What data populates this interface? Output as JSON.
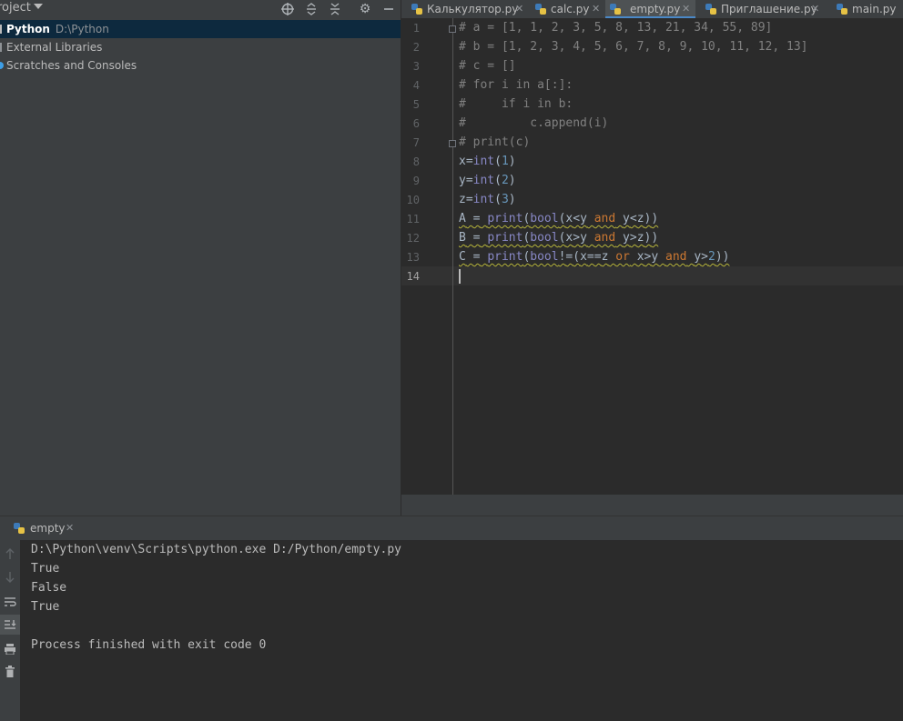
{
  "project_panel": {
    "title": "roject",
    "tree": [
      {
        "name": "Python",
        "path": "D:\\Python"
      },
      {
        "name": "External Libraries"
      },
      {
        "name": "Scratches and Consoles"
      }
    ],
    "icons": [
      "locate-icon",
      "expand-all-icon",
      "collapse-all-icon",
      "gear-icon",
      "minimize-icon"
    ]
  },
  "tabs": [
    {
      "label": "Калькулятор.py",
      "active": false
    },
    {
      "label": "calc.py",
      "active": false
    },
    {
      "label": "empty.py",
      "active": true
    },
    {
      "label": "Приглашение.py",
      "active": false
    },
    {
      "label": "main.py",
      "active": false
    }
  ],
  "tab_close_glyph": "✕",
  "editor": {
    "line_numbers": [
      "1",
      "2",
      "3",
      "4",
      "5",
      "6",
      "7",
      "8",
      "9",
      "10",
      "11",
      "12",
      "13",
      "14"
    ],
    "current_line": 14,
    "lines": [
      "# a = [1, 1, 2, 3, 5, 8, 13, 21, 34, 55, 89]",
      "# b = [1, 2, 3, 4, 5, 6, 7, 8, 9, 10, 11, 12, 13]",
      "# c = []",
      "# for i in a[:]:",
      "#     if i in b:",
      "#         c.append(i)",
      "# print(c)",
      "x=int(1)",
      "y=int(2)",
      "z=int(3)",
      "A = print(bool(x<y and y<z))",
      "B = print(bool(x>y and y>z))",
      "C = print(bool!=(x==z or x>y and y>2))",
      ""
    ]
  },
  "run": {
    "tab_label": "empty",
    "output": [
      "D:\\Python\\venv\\Scripts\\python.exe D:/Python/empty.py",
      "True",
      "False",
      "True",
      "",
      "Process finished with exit code 0"
    ],
    "toolbar": [
      "up-arrow-icon",
      "down-arrow-icon",
      "soft-wrap-icon",
      "scroll-to-end-icon",
      "print-icon",
      "trash-icon"
    ]
  },
  "colors": {
    "keyword": "#cc7832",
    "builtin": "#8888c6",
    "number": "#6897bb",
    "comment": "#808080",
    "selection": "#0d293e",
    "active_tab_underline": "#4a88c7"
  }
}
